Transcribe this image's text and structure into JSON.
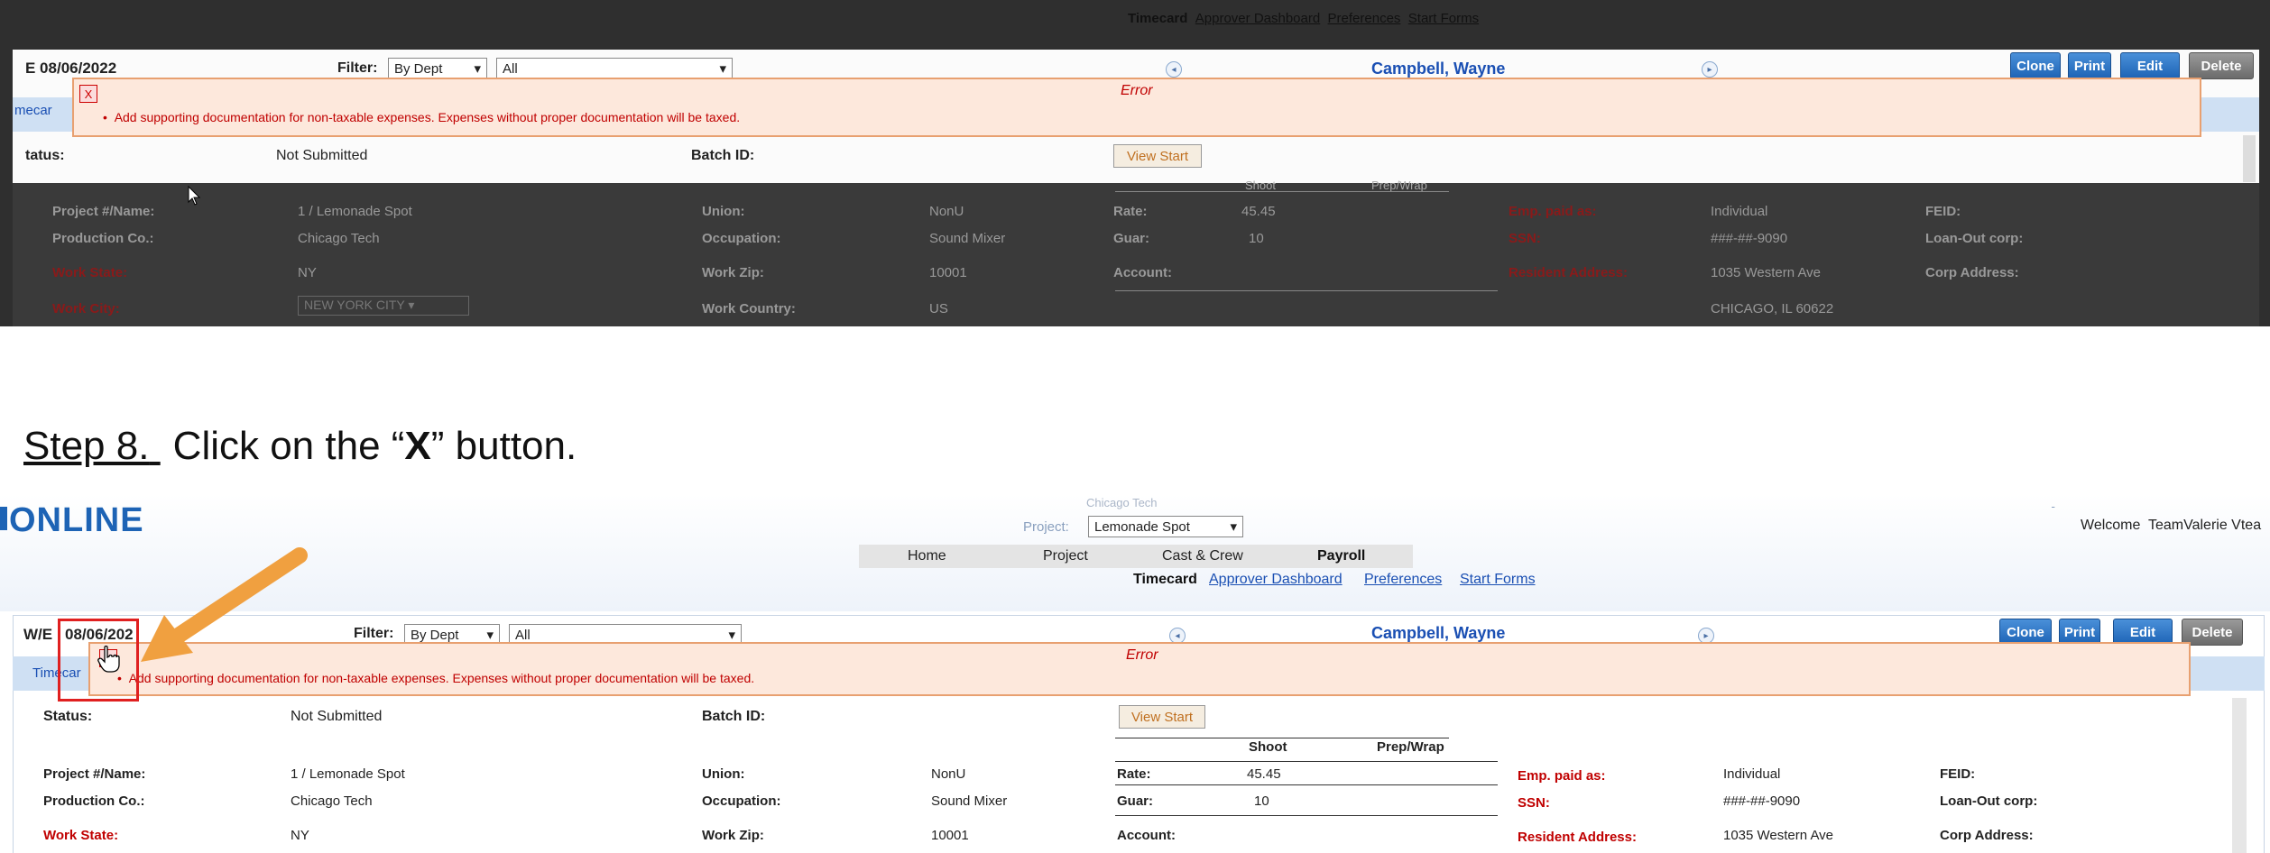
{
  "top_panel": {
    "subnav": [
      "Timecard",
      "Approver Dashboard",
      "Preferences",
      "Start Forms"
    ],
    "we_value": "E 08/06/2022",
    "filter_label": "Filter:",
    "filter_by": "By Dept",
    "filter_all": "All",
    "employee": "Campbell, Wayne",
    "buttons": [
      "Clone",
      "Print",
      "Edit",
      "Delete"
    ],
    "error_close": "X",
    "error_title": "Error",
    "error_message": "Add supporting documentation for non-taxable expenses. Expenses without proper documentation will be taxed.",
    "tab_fragment": "mecar",
    "status_label": "tatus:",
    "status_value": "Not Submitted",
    "batch_label": "Batch ID:",
    "view_start": "View Start",
    "shoot": "Shoot",
    "prepwrap": "Prep/Wrap",
    "rows": [
      [
        "Project #/Name:",
        "1 / Lemonade Spot",
        "Union:",
        "NonU",
        "Rate:",
        "45.45",
        "Emp. paid as:",
        "Individual",
        "FEID:"
      ],
      [
        "Production Co.:",
        "Chicago Tech",
        "Occupation:",
        "Sound Mixer",
        "Guar:",
        "10",
        "SSN:",
        "###-##-9090",
        "Loan-Out corp:"
      ],
      [
        "Work State:",
        "NY",
        "Work Zip:",
        "10001",
        "Account:",
        "",
        "Resident Address:",
        "1035 Western Ave",
        "Corp Address:"
      ],
      [
        "Work City:",
        "NEW YORK CITY",
        "Work Country:",
        "US",
        "",
        "",
        "",
        "CHICAGO, IL 60622",
        ""
      ]
    ]
  },
  "instruction": {
    "step": "Step 8.",
    "text_before": " Click on the “",
    "bold": "X",
    "text_after": "” button."
  },
  "bottom_panel": {
    "logo": "ONLINE",
    "project_label": "Project:",
    "project_value": "Lemonade Spot",
    "project_caption": "Chicago Tech",
    "welcome": "Welcome  TeamValerie Vtea",
    "nav": [
      "Home",
      "Project",
      "Cast & Crew",
      "Payroll"
    ],
    "subnav": [
      "Timecard",
      "Approver Dashboard",
      "Preferences",
      "Start Forms"
    ],
    "we_label": "W/E",
    "we_value": "08/06/202",
    "filter_label": "Filter:",
    "filter_by": "By Dept",
    "filter_all": "All",
    "employee": "Campbell, Wayne",
    "buttons": [
      "Clone",
      "Print",
      "Edit",
      "Delete"
    ],
    "tab_label": "Timecar",
    "error_close": "X",
    "error_title": "Error",
    "error_message": "Add supporting documentation for non-taxable expenses. Expenses without proper documentation will be taxed.",
    "status_label": "Status:",
    "status_value": "Not Submitted",
    "batch_label": "Batch ID:",
    "view_start": "View Start",
    "shoot": "Shoot",
    "prepwrap": "Prep/Wrap",
    "rows": [
      [
        "Project #/Name:",
        "1 / Lemonade Spot",
        "Union:",
        "NonU",
        "Rate:",
        "45.45",
        "Emp. paid as:",
        "Individual",
        "FEID:"
      ],
      [
        "Production Co.:",
        "Chicago Tech",
        "Occupation:",
        "Sound Mixer",
        "Guar:",
        "10",
        "SSN:",
        "###-##-9090",
        "Loan-Out corp:"
      ],
      [
        "Work State:",
        "NY",
        "Work Zip:",
        "10001",
        "Account:",
        "",
        "Resident Address:",
        "1035 Western Ave",
        "Corp Address:"
      ]
    ]
  },
  "colors": {
    "accent_blue": "#1d63b5",
    "error_red": "#c00000",
    "highlight_red": "#e02020",
    "arrow_orange": "#f0a040"
  }
}
